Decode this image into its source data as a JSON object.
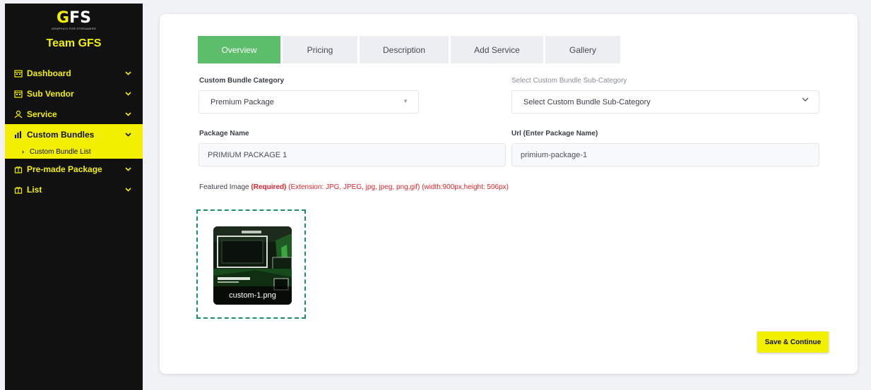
{
  "brand": {
    "logo_text_1": "G",
    "logo_text_2": "FS",
    "logo_tagline": "GRAPHICS FOR STREAMERS",
    "team_name": "Team GFS"
  },
  "sidebar": {
    "items": [
      {
        "label": "Dashboard",
        "icon": "calendar-icon"
      },
      {
        "label": "Sub Vendor",
        "icon": "calendar-icon"
      },
      {
        "label": "Service",
        "icon": "service-icon"
      },
      {
        "label": "Custom Bundles",
        "icon": "chart-icon",
        "active": true
      },
      {
        "label": "Pre-made Package",
        "icon": "package-icon"
      },
      {
        "label": "List",
        "icon": "package-icon"
      }
    ],
    "submenu": {
      "label": "Custom Bundle List"
    }
  },
  "tabs": [
    {
      "label": "Overview",
      "active": true
    },
    {
      "label": "Pricing"
    },
    {
      "label": "Description"
    },
    {
      "label": "Add Service"
    },
    {
      "label": "Gallery"
    }
  ],
  "form": {
    "category": {
      "label": "Custom Bundle Category",
      "value": "Premium Package"
    },
    "subcategory": {
      "label": "Select Custom Bundle Sub-Category",
      "value": "Select Custom Bundle Sub-Category"
    },
    "package_name": {
      "label": "Package Name",
      "value": "PRIMIUM PACKAGE 1"
    },
    "url": {
      "label": "Url (Enter Package Name)",
      "value": "primium-package-1"
    },
    "featured_image": {
      "label": "Featured Image",
      "required": "(Required)",
      "extension_note": "(Extension: JPG, JPEG, jpg, jpeg, png,gif) (width:900px,height: 506px)",
      "filename": "custom-1.png"
    }
  },
  "actions": {
    "save_label": "Save & Continue"
  },
  "colors": {
    "accent_yellow": "#f2ef00",
    "active_tab_green": "#5cbd6a",
    "required_red": "#e0242b",
    "dropzone_border": "#198f6c",
    "sidebar_bg": "#111111"
  }
}
